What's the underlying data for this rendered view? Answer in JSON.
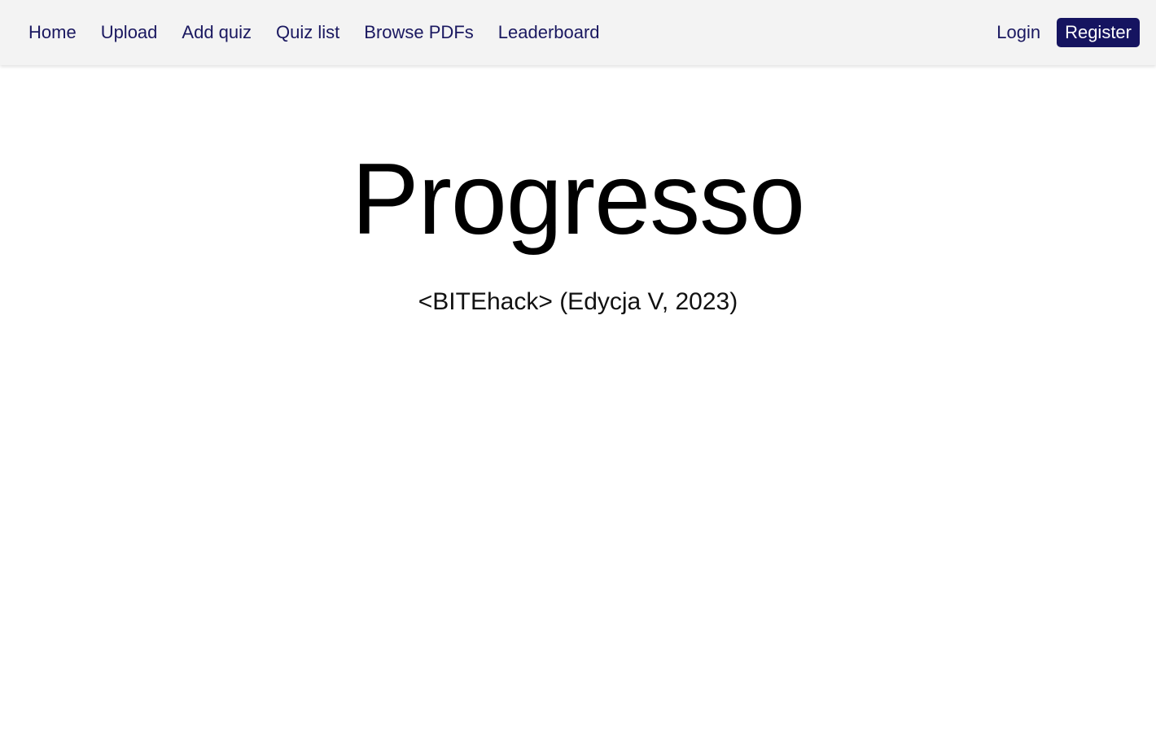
{
  "nav": {
    "links": [
      {
        "label": "Home"
      },
      {
        "label": "Upload"
      },
      {
        "label": "Add quiz"
      },
      {
        "label": "Quiz list"
      },
      {
        "label": "Browse PDFs"
      },
      {
        "label": "Leaderboard"
      }
    ],
    "login_label": "Login",
    "register_label": "Register"
  },
  "hero": {
    "title": "Progresso",
    "subtitle": "<BITEhack> (Edycja V, 2023)"
  },
  "colors": {
    "nav_background": "#f3f3f3",
    "nav_text": "#1a1860",
    "register_background": "#151460",
    "register_text": "#ffffff",
    "page_background": "#ffffff"
  }
}
